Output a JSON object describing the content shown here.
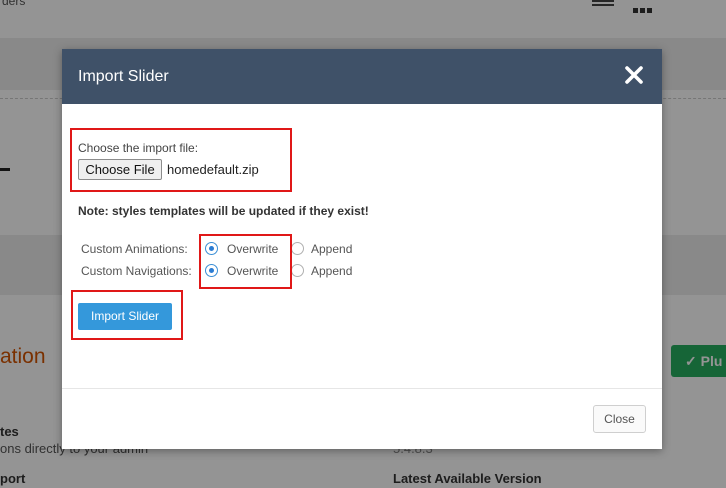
{
  "background": {
    "top_text": "ders",
    "heading": "ation",
    "left_col": {
      "title": "tes",
      "desc": "ons directly to your admin",
      "subtitle": "port"
    },
    "right_col": {
      "version": "5.4.8.3",
      "subtitle": "Latest Available Version"
    },
    "plugin_button": "Plu"
  },
  "modal": {
    "title": "Import Slider",
    "file_label": "Choose the import file:",
    "choose_file_label": "Choose File",
    "file_name": "homedefault.zip",
    "note": "Note: styles templates will be updated if they exist!",
    "rows": [
      {
        "label": "Custom Animations:",
        "selected": "Overwrite",
        "options": [
          "Overwrite",
          "Append"
        ]
      },
      {
        "label": "Custom Navigations:",
        "selected": "Overwrite",
        "options": [
          "Overwrite",
          "Append"
        ]
      }
    ],
    "import_label": "Import Slider",
    "close_label": "Close"
  },
  "colors": {
    "header_bg": "#3f5168",
    "primary_button": "#3498db",
    "highlight": "#e01818",
    "radio_accent": "#2b7cd3"
  },
  "icons": {
    "close": "close-icon",
    "menu": "menu-icon",
    "grid": "grid-icon",
    "check": "check-icon"
  }
}
